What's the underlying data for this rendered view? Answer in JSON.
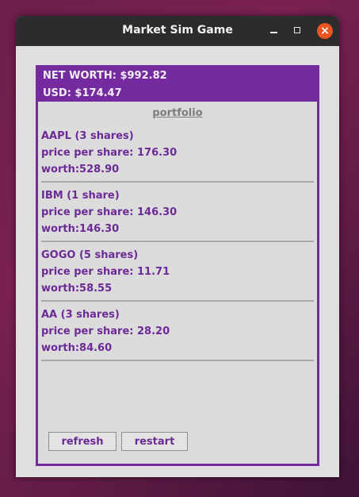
{
  "window": {
    "title": "Market Sim Game",
    "close_glyph": "×"
  },
  "summary": {
    "net_worth": "NET WORTH: $992.82",
    "usd": "USD: $174.47"
  },
  "portfolio": {
    "title": "portfolio",
    "stocks": [
      {
        "name": "AAPL (3 shares)",
        "price": "price per share: 176.30",
        "worth": "worth:528.90"
      },
      {
        "name": "IBM (1 share)",
        "price": "price per share: 146.30",
        "worth": "worth:146.30"
      },
      {
        "name": "GOGO (5 shares)",
        "price": "price per share: 11.71",
        "worth": "worth:58.55"
      },
      {
        "name": "AA (3 shares)",
        "price": "price per share: 28.20",
        "worth": "worth:84.60"
      }
    ]
  },
  "buttons": {
    "refresh": "refresh",
    "restart": "restart"
  },
  "colors": {
    "accent": "#762aa0",
    "close": "#e95420"
  }
}
